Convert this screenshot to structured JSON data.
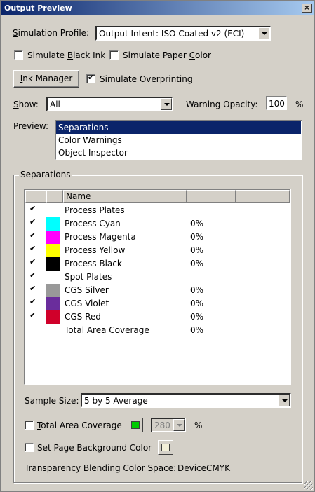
{
  "window": {
    "title": "Output Preview",
    "close": "×"
  },
  "simulation_profile": {
    "label": "Simulation Profile:",
    "value": "Output Intent: ISO Coated v2 (ECI)"
  },
  "simulate_black_ink": {
    "label": "Simulate Black Ink",
    "checked": false
  },
  "simulate_paper_color": {
    "label": "Simulate Paper Color",
    "checked": false
  },
  "ink_manager": {
    "label": "Ink Manager"
  },
  "simulate_overprinting": {
    "label": "Simulate Overprinting",
    "checked": true
  },
  "show": {
    "label": "Show:",
    "value": "All"
  },
  "warning_opacity": {
    "label": "Warning Opacity:",
    "value": "100",
    "unit": "%"
  },
  "preview": {
    "label": "Preview:",
    "items": [
      "Separations",
      "Color Warnings",
      "Object Inspector"
    ],
    "selected": 0
  },
  "separations": {
    "group_title": "Separations",
    "columns": [
      "",
      "",
      "Name",
      "",
      ""
    ],
    "rows": [
      {
        "checked": true,
        "color": "",
        "name": "Process Plates",
        "pct": ""
      },
      {
        "checked": true,
        "color": "#00ffff",
        "name": "Process Cyan",
        "pct": "0%"
      },
      {
        "checked": true,
        "color": "#ff00ff",
        "name": "Process Magenta",
        "pct": "0%"
      },
      {
        "checked": true,
        "color": "#ffff00",
        "name": "Process Yellow",
        "pct": "0%"
      },
      {
        "checked": true,
        "color": "#000000",
        "name": "Process Black",
        "pct": "0%"
      },
      {
        "checked": true,
        "color": "",
        "name": "Spot Plates",
        "pct": ""
      },
      {
        "checked": true,
        "color": "#999999",
        "name": "CGS Silver",
        "pct": "0%"
      },
      {
        "checked": true,
        "color": "#6a2d9c",
        "name": "CGS Violet",
        "pct": "0%"
      },
      {
        "checked": true,
        "color": "#d0002a",
        "name": "CGS Red",
        "pct": "0%"
      },
      {
        "checked": false,
        "color": "",
        "name": "Total Area Coverage",
        "pct": "0%"
      }
    ]
  },
  "sample_size": {
    "label": "Sample Size:",
    "value": "5 by 5 Average"
  },
  "total_area_coverage": {
    "label": "Total Area Coverage",
    "checked": false,
    "color": "#00cc00",
    "value": "280",
    "unit": "%"
  },
  "page_background": {
    "label": "Set Page Background Color",
    "checked": false,
    "color": "#f2efd8"
  },
  "transparency": {
    "label": "Transparency Blending Color Space:",
    "value": "DeviceCMYK"
  }
}
